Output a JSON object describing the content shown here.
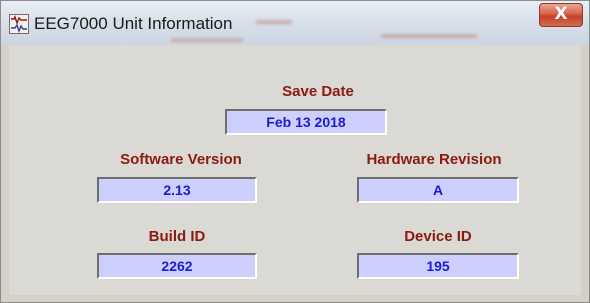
{
  "window": {
    "title": "EEG7000 Unit Information",
    "close_label": "X"
  },
  "fields": {
    "save_date": {
      "label": "Save Date",
      "value": "Feb 13 2018"
    },
    "software_version": {
      "label": "Software Version",
      "value": "2.13"
    },
    "hardware_revision": {
      "label": "Hardware Revision",
      "value": "A"
    },
    "build_id": {
      "label": "Build ID",
      "value": "2262"
    },
    "device_id": {
      "label": "Device ID",
      "value": "195"
    }
  },
  "colors": {
    "label_text": "#8b1a12",
    "value_text": "#1b1bd6",
    "field_background": "#cdd0ff",
    "dialog_background": "#dbd9d3",
    "close_button": "#c5402a"
  },
  "icons": {
    "app_icon": "waveform-icon",
    "close_icon": "close-icon"
  }
}
